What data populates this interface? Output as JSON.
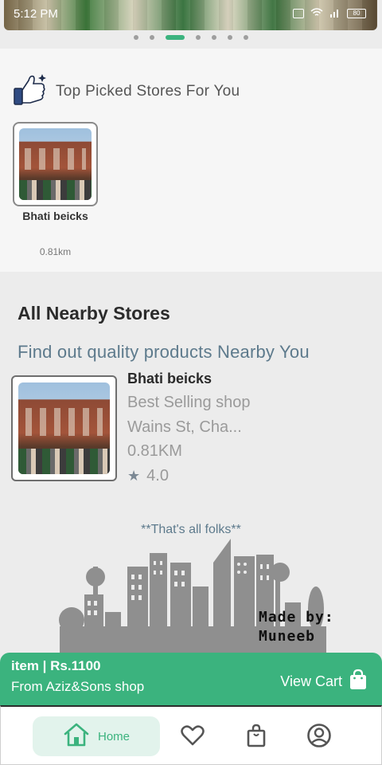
{
  "status_bar": {
    "time": "5:12 PM",
    "battery": "80"
  },
  "carousel": {
    "page_count": 7,
    "active_index": 2
  },
  "top_picked": {
    "title": "Top Picked Stores For You",
    "stores": [
      {
        "name": "Bhati beicks",
        "distance": "0.81km"
      }
    ]
  },
  "nearby": {
    "title": "All Nearby Stores",
    "subtitle": "Find out quality products Nearby You",
    "stores": [
      {
        "name": "Bhati beicks",
        "description": "Best Selling shop",
        "address": "Wains St, Cha...",
        "distance": "0.81KM",
        "rating": "4.0"
      }
    ]
  },
  "footer_note": "**That's all folks**",
  "made_by": {
    "line1": "Made by:",
    "line2": "Muneeb"
  },
  "cart": {
    "item_summary": "item | Rs.1100",
    "shop_text": "From Aziz&Sons shop",
    "view_label": "View Cart"
  },
  "nav": {
    "home_label": "Home"
  },
  "colors": {
    "accent": "#3bb37e",
    "subtitle": "#5d7a8c"
  }
}
